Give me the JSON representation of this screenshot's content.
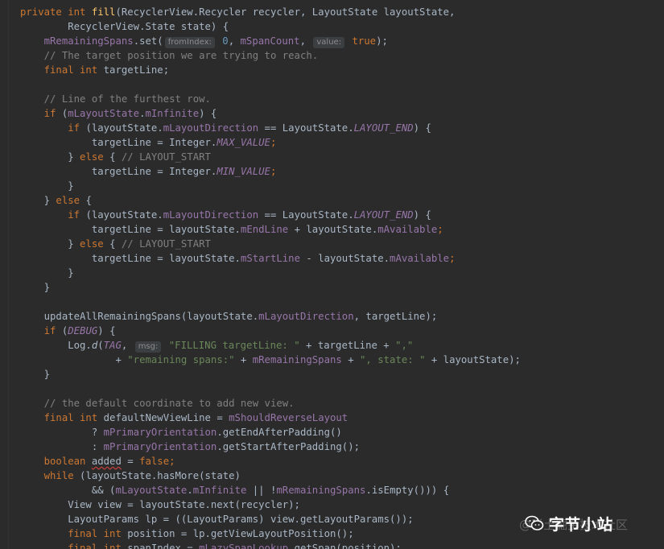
{
  "editor": {
    "lines": [
      [
        [
          "kw",
          "private int "
        ],
        [
          "mth",
          "fill"
        ],
        [
          "",
          "(RecyclerView.Recycler recycler, LayoutState layoutState,"
        ]
      ],
      [
        [
          "",
          "        RecyclerView.State state) {"
        ]
      ],
      [
        [
          "",
          "    "
        ],
        [
          "fld",
          "mRemainingSpans"
        ],
        [
          "",
          ".set("
        ],
        [
          "hint",
          "fromIndex:"
        ],
        [
          "num",
          " 0"
        ],
        [
          "",
          ", "
        ],
        [
          "fld",
          "mSpanCount"
        ],
        [
          "",
          ", "
        ],
        [
          "hint",
          "value:"
        ],
        [
          "kw",
          " true"
        ],
        [
          "",
          ");"
        ]
      ],
      [
        [
          "cmt",
          "    // The target position we are trying to reach."
        ]
      ],
      [
        [
          "kw",
          "    final int "
        ],
        [
          "",
          "targetLine;"
        ]
      ],
      [
        [
          "",
          "  "
        ]
      ],
      [
        [
          "cmt",
          "    // Line of the furthest row."
        ]
      ],
      [
        [
          "kw",
          "    if "
        ],
        [
          "",
          "("
        ],
        [
          "fld",
          "mLayoutState"
        ],
        [
          "",
          "."
        ],
        [
          "fld",
          "mInfinite"
        ],
        [
          "",
          ") {"
        ]
      ],
      [
        [
          "kw",
          "        if "
        ],
        [
          "",
          "(layoutState."
        ],
        [
          "fld",
          "mLayoutDirection"
        ],
        [
          "",
          " == LayoutState."
        ],
        [
          "itf",
          "LAYOUT_END"
        ],
        [
          "",
          ") {"
        ]
      ],
      [
        [
          "",
          "            targetLine = Integer."
        ],
        [
          "itf",
          "MAX_VALUE"
        ],
        [
          "kw",
          ";"
        ]
      ],
      [
        [
          "",
          "        } "
        ],
        [
          "kw",
          "else "
        ],
        [
          "",
          "{ "
        ],
        [
          "cmt",
          "// LAYOUT_START"
        ]
      ],
      [
        [
          "",
          "            targetLine = Integer."
        ],
        [
          "itf",
          "MIN_VALUE"
        ],
        [
          "kw",
          ";"
        ]
      ],
      [
        [
          "",
          "        }"
        ]
      ],
      [
        [
          "",
          "    } "
        ],
        [
          "kw",
          "else "
        ],
        [
          "",
          "{"
        ]
      ],
      [
        [
          "kw",
          "        if "
        ],
        [
          "",
          "(layoutState."
        ],
        [
          "fld",
          "mLayoutDirection"
        ],
        [
          "",
          " == LayoutState."
        ],
        [
          "itf",
          "LAYOUT_END"
        ],
        [
          "",
          ") {"
        ]
      ],
      [
        [
          "",
          "            targetLine = layoutState."
        ],
        [
          "fld",
          "mEndLine"
        ],
        [
          "",
          " + layoutState."
        ],
        [
          "fld",
          "mAvailable"
        ],
        [
          "kw",
          ";"
        ]
      ],
      [
        [
          "",
          "        } "
        ],
        [
          "kw",
          "else "
        ],
        [
          "",
          "{ "
        ],
        [
          "cmt",
          "// LAYOUT_START"
        ]
      ],
      [
        [
          "",
          "            targetLine = layoutState."
        ],
        [
          "fld",
          "mStartLine"
        ],
        [
          "",
          " - layoutState."
        ],
        [
          "fld",
          "mAvailable"
        ],
        [
          "kw",
          ";"
        ]
      ],
      [
        [
          "",
          "        }"
        ]
      ],
      [
        [
          "",
          "    }"
        ]
      ],
      [
        [
          "",
          "  "
        ]
      ],
      [
        [
          "",
          "    updateAllRemainingSpans(layoutState."
        ],
        [
          "fld",
          "mLayoutDirection"
        ],
        [
          "",
          ", targetLine);"
        ]
      ],
      [
        [
          "kw",
          "    if "
        ],
        [
          "",
          "("
        ],
        [
          "itf",
          "DEBUG"
        ],
        [
          "",
          ") {"
        ]
      ],
      [
        [
          "",
          "        Log."
        ],
        [
          "st",
          "d"
        ],
        [
          "",
          "("
        ],
        [
          "itf",
          "TAG"
        ],
        [
          "",
          ", "
        ],
        [
          "hint",
          "msg:"
        ],
        [
          "str",
          " \"FILLING targetLine: \""
        ],
        [
          "",
          " + targetLine + "
        ],
        [
          "str",
          "\",\""
        ]
      ],
      [
        [
          "",
          "                + "
        ],
        [
          "str",
          "\"remaining spans:\""
        ],
        [
          "",
          " + "
        ],
        [
          "fld",
          "mRemainingSpans"
        ],
        [
          "",
          " + "
        ],
        [
          "str",
          "\", state: \""
        ],
        [
          "",
          " + layoutState);"
        ]
      ],
      [
        [
          "",
          "    }"
        ]
      ],
      [
        [
          "",
          "  "
        ]
      ],
      [
        [
          "cmt",
          "    // the default coordinate to add new view."
        ]
      ],
      [
        [
          "kw",
          "    final int "
        ],
        [
          "",
          "defaultNewViewLine = "
        ],
        [
          "fld",
          "mShouldReverseLayout"
        ]
      ],
      [
        [
          "",
          "            ? "
        ],
        [
          "fld",
          "mPrimaryOrientation"
        ],
        [
          "",
          ".getEndAfterPadding()"
        ]
      ],
      [
        [
          "",
          "            : "
        ],
        [
          "fld",
          "mPrimaryOrientation"
        ],
        [
          "",
          ".getStartAfterPadding();"
        ]
      ],
      [
        [
          "kw",
          "    boolean "
        ],
        [
          "squig",
          "added"
        ],
        [
          "",
          " = "
        ],
        [
          "kw",
          "false;"
        ]
      ],
      [
        [
          "kw",
          "    while "
        ],
        [
          "",
          "(layoutState.hasMore(state)"
        ]
      ],
      [
        [
          "",
          "            && ("
        ],
        [
          "fld",
          "mLayoutState"
        ],
        [
          "",
          "."
        ],
        [
          "fld",
          "mInfinite"
        ],
        [
          "",
          " || !"
        ],
        [
          "fld",
          "mRemainingSpans"
        ],
        [
          "",
          ".isEmpty())) {"
        ]
      ],
      [
        [
          "",
          "        View view = layoutState.next(recycler);"
        ]
      ],
      [
        [
          "",
          "        LayoutParams lp = ((LayoutParams) view.getLayoutParams());"
        ]
      ],
      [
        [
          "kw",
          "        final int "
        ],
        [
          "",
          "position = lp.getViewLayoutPosition();"
        ]
      ],
      [
        [
          "kw",
          "        final int "
        ],
        [
          "",
          "spanIndex = "
        ],
        [
          "fld",
          "mLazySpanLookup"
        ],
        [
          "",
          ".getSpan(position);"
        ]
      ]
    ]
  },
  "watermark": {
    "title": "字节小站",
    "credit": "@稀土掘金技术社区"
  }
}
